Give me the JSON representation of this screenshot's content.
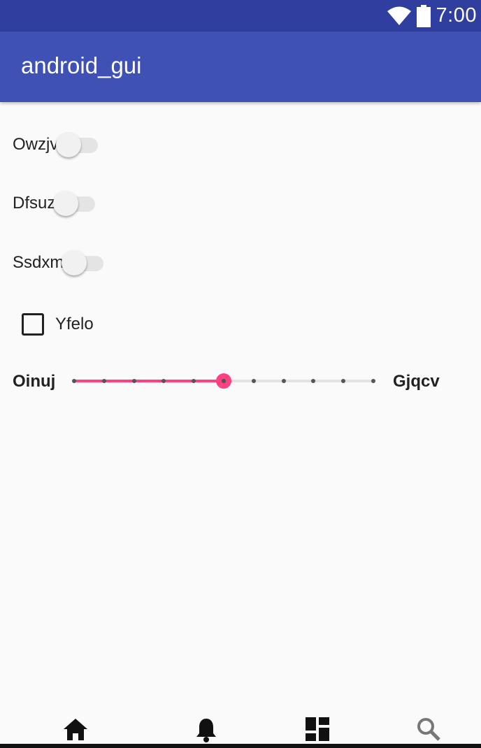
{
  "status_bar": {
    "time": "7:00"
  },
  "app_bar": {
    "title": "android_gui"
  },
  "switches": [
    {
      "label": "Owzjv",
      "on": false
    },
    {
      "label": "Dfsuz",
      "on": false
    },
    {
      "label": "Ssdxm",
      "on": false
    }
  ],
  "checkbox": {
    "label": "Yfelo",
    "checked": false
  },
  "slider": {
    "min_label": "Oinuj",
    "max_label": "Gjqcv",
    "steps": 10,
    "value": 5,
    "accent": "#ff4081"
  },
  "bottom_nav": [
    "home-icon",
    "bell-icon",
    "dashboard-icon",
    "search-icon"
  ],
  "colors": {
    "status_bar": "#303f9f",
    "app_bar": "#3f51b5",
    "accent": "#ff4081"
  }
}
